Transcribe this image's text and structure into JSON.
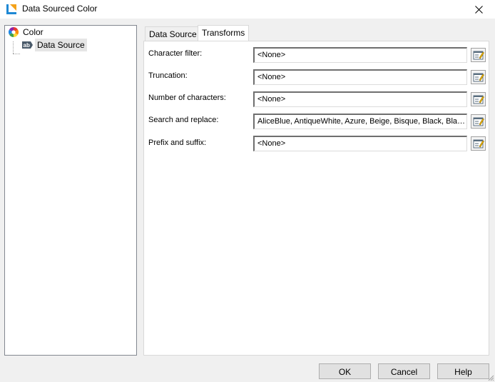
{
  "window": {
    "title": "Data Sourced Color"
  },
  "tree": {
    "items": [
      {
        "label": "Color"
      },
      {
        "label": "Data Source"
      }
    ]
  },
  "tabs": [
    {
      "label": "Data Source"
    },
    {
      "label": "Transforms"
    }
  ],
  "transforms": {
    "rows": [
      {
        "label": "Character filter:",
        "value": "<None>"
      },
      {
        "label": "Truncation:",
        "value": "<None>"
      },
      {
        "label": "Number of characters:",
        "value": "<None>"
      },
      {
        "label": "Search and replace:",
        "value": "AliceBlue, AntiqueWhite, Azure, Beige, Bisque, Black, BlanchedAlmond"
      },
      {
        "label": "Prefix and suffix:",
        "value": "<None>"
      }
    ]
  },
  "buttons": {
    "ok": "OK",
    "cancel": "Cancel",
    "help": "Help"
  }
}
